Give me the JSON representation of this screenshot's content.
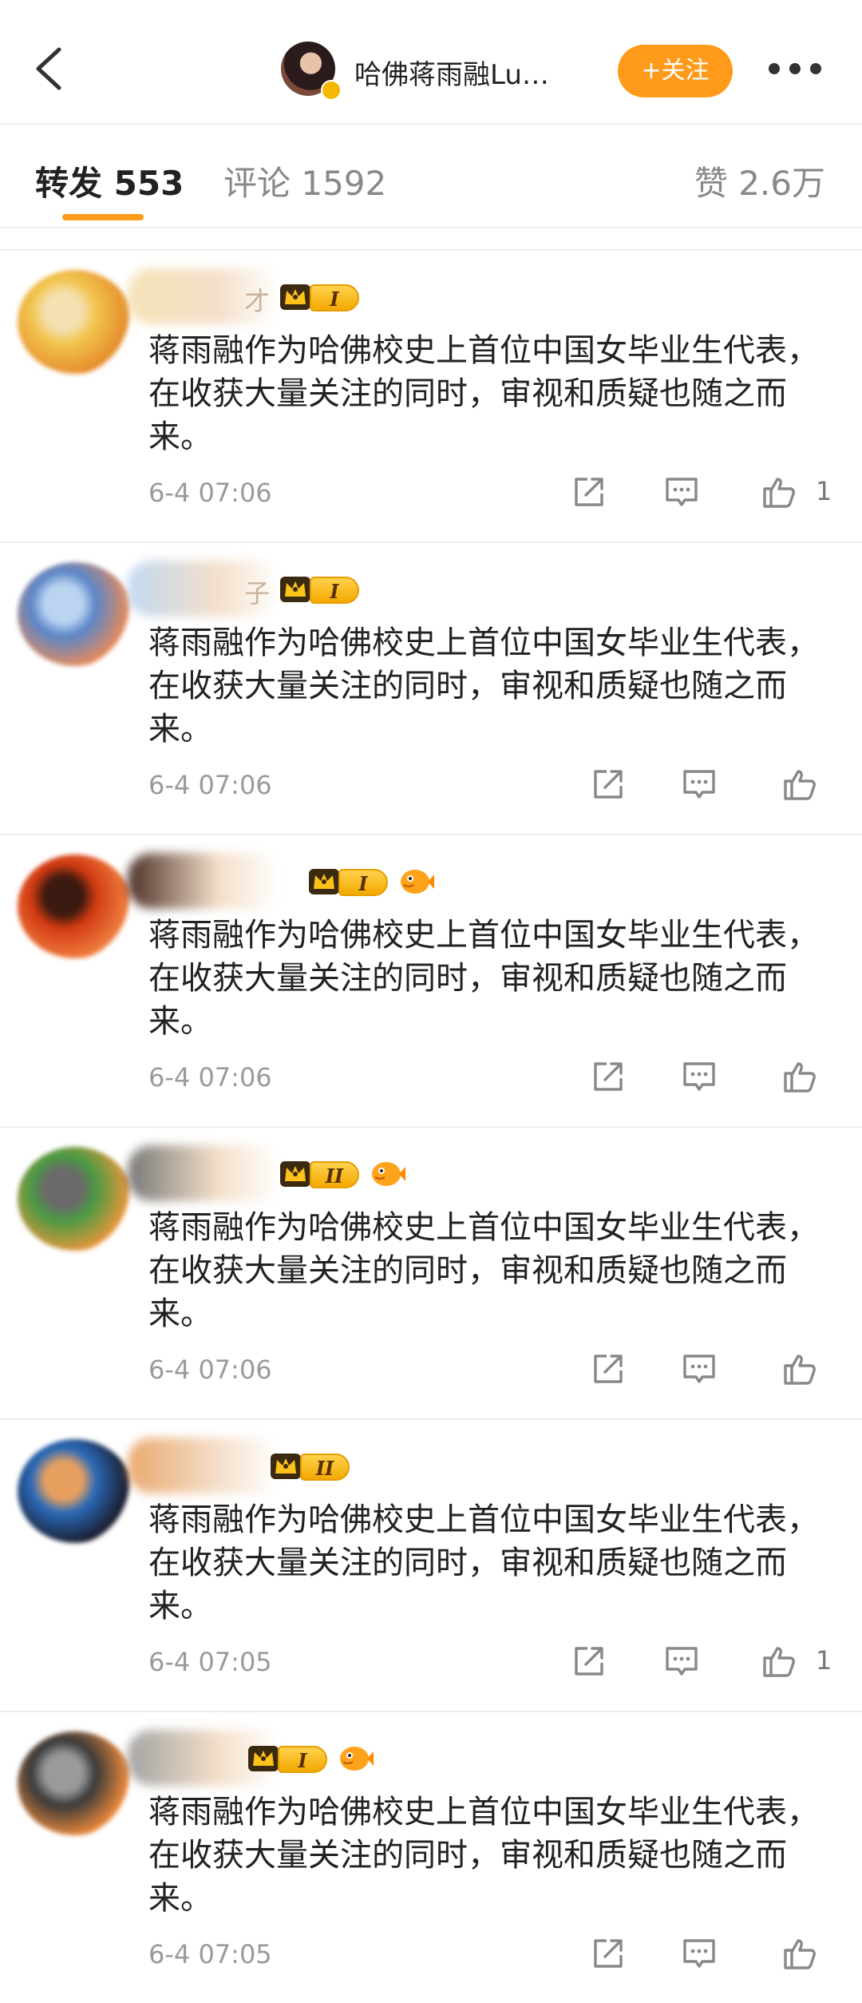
{
  "header": {
    "name": "哈佛蒋雨融Lu…",
    "follow_label": "+关注"
  },
  "tabs": {
    "repost": "转发 553",
    "comment": "评论 1592",
    "like": "赞 2.6万"
  },
  "comments": [
    {
      "name_suffix": "才",
      "level": "I",
      "has_fish": false,
      "text": "蒋雨融作为哈佛校史上首位中国女毕业生代表，在收获大量关注的同时，审视和质疑也随之而来。",
      "time": "6-4 07:06",
      "likes": "1",
      "avatar_colors": [
        "#f2c44d",
        "#e58b2a",
        "#f4e0b0"
      ]
    },
    {
      "name_suffix": "子",
      "level": "I",
      "has_fish": false,
      "text": "蒋雨融作为哈佛校史上首位中国女毕业生代表，在收获大量关注的同时，审视和质疑也随之而来。",
      "time": "6-4 07:06",
      "likes": "",
      "avatar_colors": [
        "#5a86c8",
        "#e88a5a",
        "#bcd4f0"
      ]
    },
    {
      "name_suffix": "",
      "level": "I",
      "has_fish": true,
      "text": "蒋雨融作为哈佛校史上首位中国女毕业生代表，在收获大量关注的同时，审视和质疑也随之而来。",
      "time": "6-4 07:06",
      "likes": "",
      "avatar_colors": [
        "#d23a12",
        "#f08040",
        "#3a1a10"
      ]
    },
    {
      "name_suffix": "",
      "level": "II",
      "has_fish": true,
      "text": "蒋雨融作为哈佛校史上首位中国女毕业生代表，在收获大量关注的同时，审视和质疑也随之而来。",
      "time": "6-4 07:06",
      "likes": "",
      "avatar_colors": [
        "#4a9a44",
        "#e8963a",
        "#6a6a6a"
      ]
    },
    {
      "name_suffix": "",
      "level": "II",
      "has_fish": false,
      "text": "蒋雨融作为哈佛校史上首位中国女毕业生代表，在收获大量关注的同时，审视和质疑也随之而来。",
      "time": "6-4 07:05",
      "likes": "1",
      "avatar_colors": [
        "#2a6ab8",
        "#1a1a2a",
        "#e8a060"
      ]
    },
    {
      "name_suffix": "",
      "level": "I",
      "has_fish": true,
      "text": "蒋雨融作为哈佛校史上首位中国女毕业生代表，在收获大量关注的同时，审视和质疑也随之而来。",
      "time": "6-4 07:05",
      "likes": "",
      "avatar_colors": [
        "#3a3a3a",
        "#f08a3a",
        "#9a9a9a"
      ]
    }
  ]
}
